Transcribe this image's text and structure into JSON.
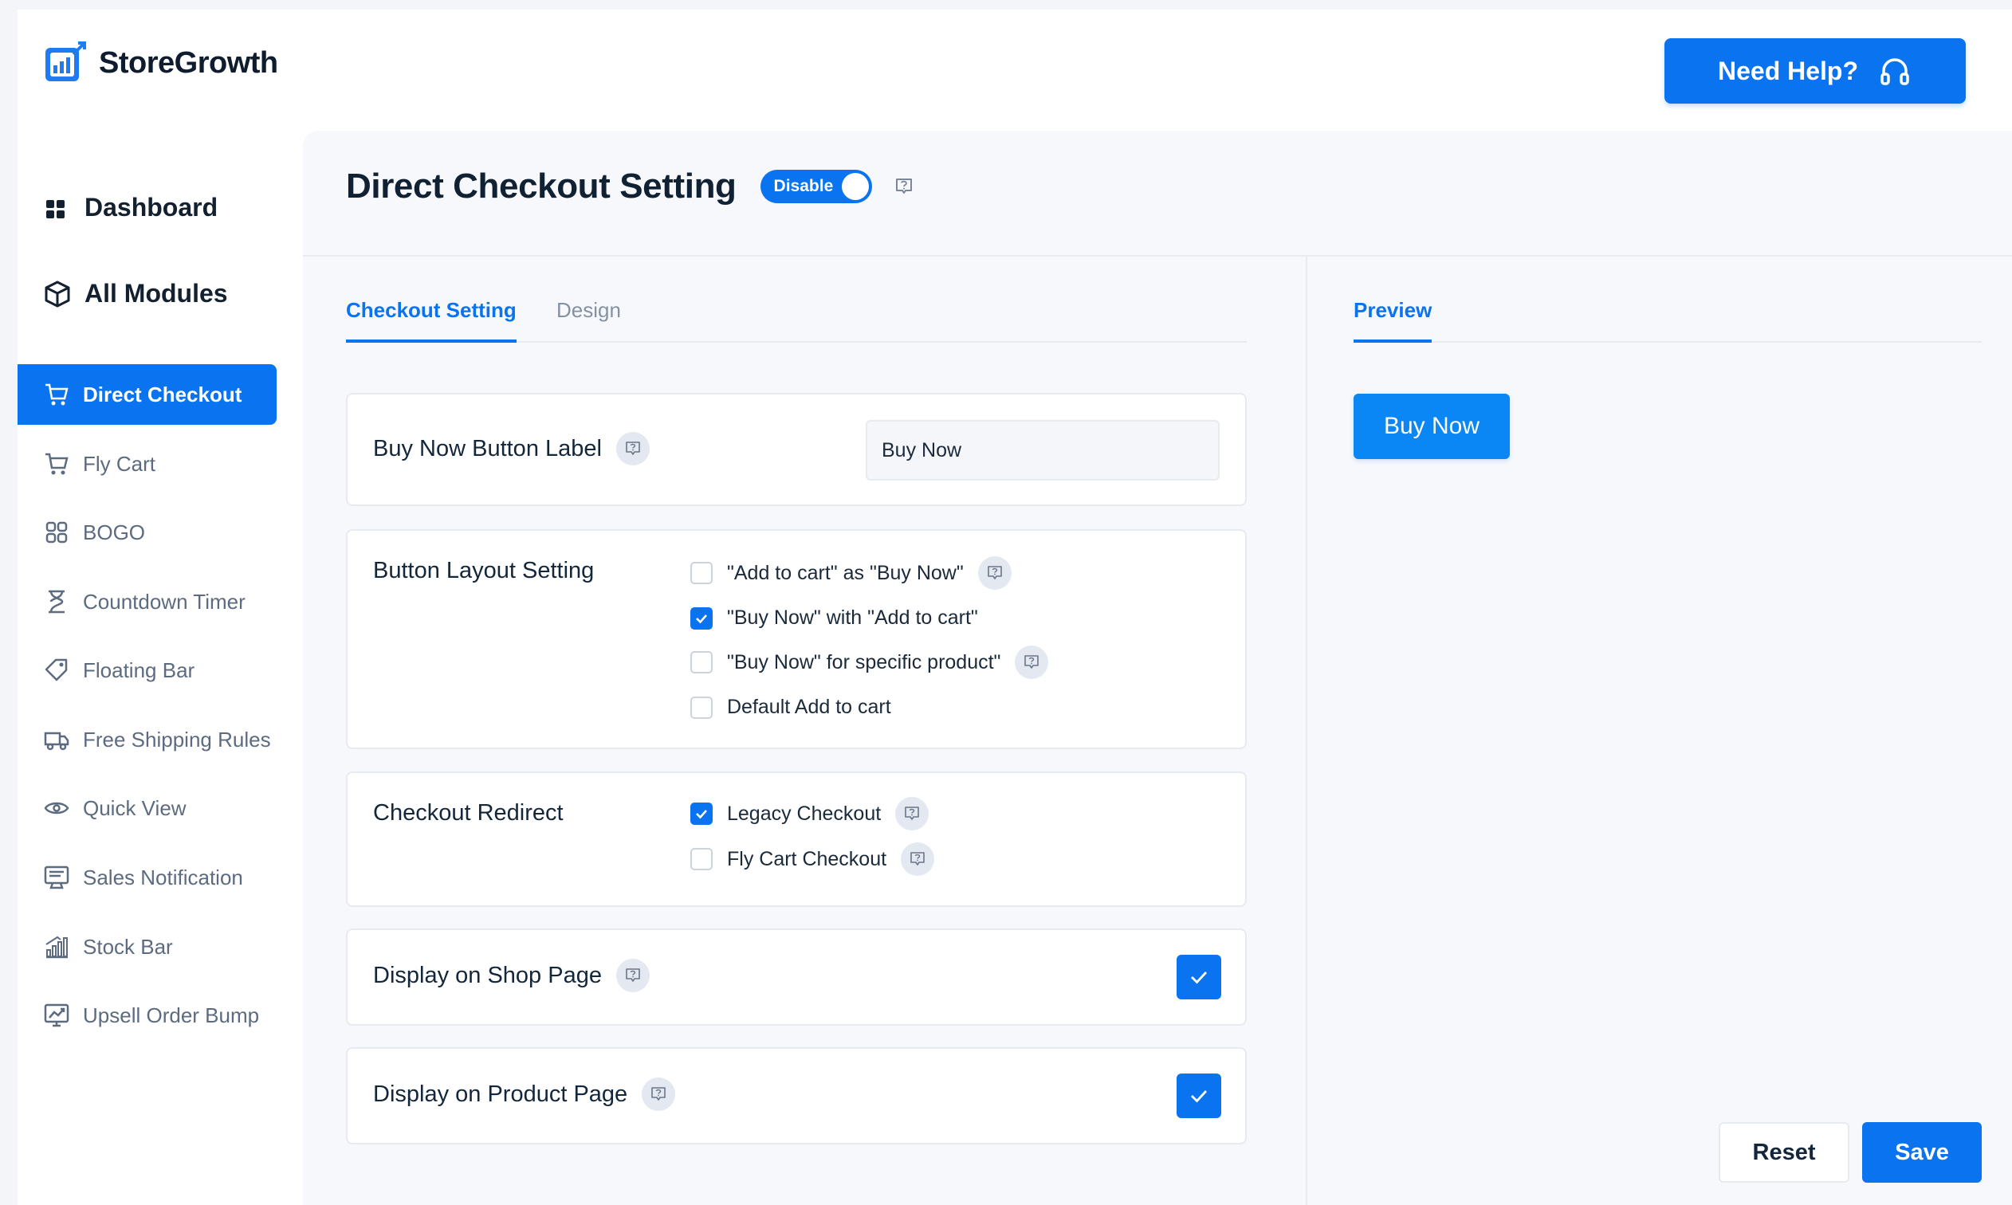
{
  "brand": {
    "name": "StoreGrowth"
  },
  "header": {
    "help_label": "Need Help?"
  },
  "sidebar": {
    "dashboard": "Dashboard",
    "all_modules": "All Modules",
    "items": [
      {
        "label": "Direct Checkout",
        "icon": "cart-icon",
        "active": true
      },
      {
        "label": "Fly Cart",
        "icon": "cart-icon"
      },
      {
        "label": "BOGO",
        "icon": "grid-icon"
      },
      {
        "label": "Countdown Timer",
        "icon": "hourglass-icon"
      },
      {
        "label": "Floating Bar",
        "icon": "tag-icon"
      },
      {
        "label": "Free Shipping Rules",
        "icon": "truck-icon"
      },
      {
        "label": "Quick View",
        "icon": "eye-icon"
      },
      {
        "label": "Sales Notification",
        "icon": "notification-icon"
      },
      {
        "label": "Stock Bar",
        "icon": "bar-chart-icon"
      },
      {
        "label": "Upsell Order Bump",
        "icon": "trend-icon"
      }
    ]
  },
  "page": {
    "title": "Direct Checkout Setting",
    "toggle_label": "Disable"
  },
  "tabs": {
    "checkout": "Checkout Setting",
    "design": "Design"
  },
  "settings": {
    "buy_now_label": {
      "title": "Buy Now Button Label",
      "value": "Buy Now"
    },
    "button_layout": {
      "title": "Button Layout Setting",
      "options": [
        {
          "label": "\"Add to cart\" as \"Buy Now\"",
          "checked": false,
          "info": true
        },
        {
          "label": "\"Buy Now\" with \"Add to cart\"",
          "checked": true,
          "info": false
        },
        {
          "label": "\"Buy Now\" for specific product\"",
          "checked": false,
          "info": true
        },
        {
          "label": "Default Add to cart",
          "checked": false,
          "info": false
        }
      ]
    },
    "checkout_redirect": {
      "title": "Checkout Redirect",
      "options": [
        {
          "label": "Legacy Checkout",
          "checked": true
        },
        {
          "label": "Fly Cart Checkout",
          "checked": false
        }
      ]
    },
    "shop_page": {
      "title": "Display on Shop Page",
      "checked": true
    },
    "product_page": {
      "title": "Display on Product Page",
      "checked": true
    }
  },
  "preview": {
    "tab": "Preview",
    "button_label": "Buy Now"
  },
  "actions": {
    "reset": "Reset",
    "save": "Save"
  },
  "colors": {
    "accent": "#0a73f0",
    "preview_button": "#0a87f5"
  }
}
